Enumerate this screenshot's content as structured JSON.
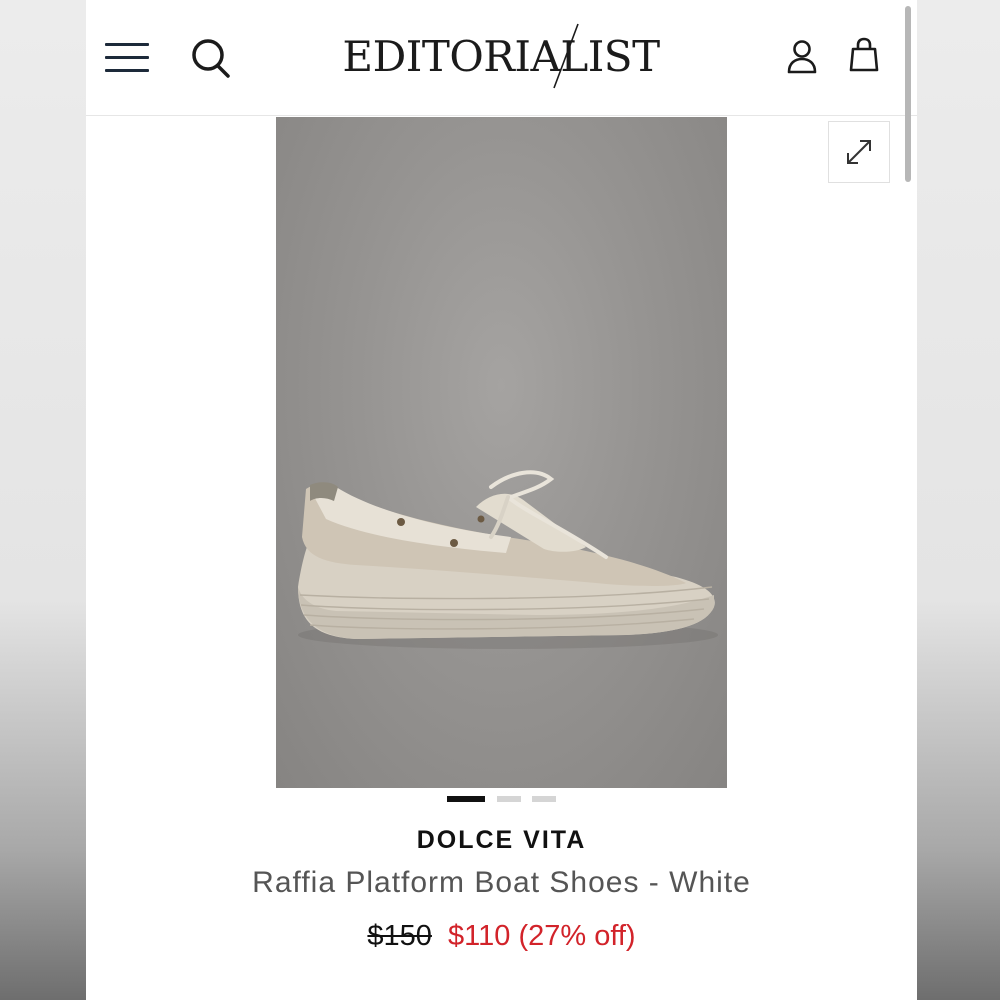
{
  "header": {
    "logo_text": "EDITORIALIST",
    "menu_icon": "hamburger-menu-icon",
    "search_icon": "search-icon",
    "account_icon": "user-account-icon",
    "bag_icon": "shopping-bag-icon"
  },
  "gallery": {
    "expand_icon": "expand-icon",
    "slide_count": 3,
    "active_slide": 1
  },
  "product": {
    "brand": "DOLCE VITA",
    "name": "Raffia Platform Boat Shoes - White",
    "original_price": "$150",
    "sale_price": "$110",
    "discount": "(27% off)"
  },
  "colors": {
    "sale_red": "#d2232a",
    "ink": "#111111",
    "muted_text": "#555555"
  }
}
